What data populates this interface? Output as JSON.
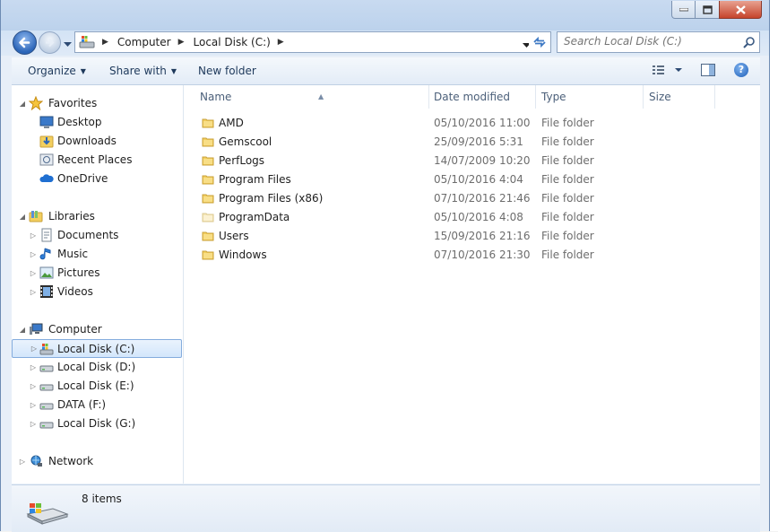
{
  "window": {
    "controls": {
      "minimize": "minimize-icon",
      "maximize": "maximize-icon",
      "close": "close-icon"
    }
  },
  "address": {
    "crumbs": [
      "Computer",
      "Local Disk (C:)"
    ],
    "icon": "local-disk-icon"
  },
  "search": {
    "placeholder": "Search Local Disk (C:)"
  },
  "toolbar": {
    "organize": "Organize",
    "share_with": "Share with",
    "new_folder": "New folder",
    "help": "?"
  },
  "nav": {
    "favorites": {
      "label": "Favorites",
      "items": [
        "Desktop",
        "Downloads",
        "Recent Places",
        "OneDrive"
      ]
    },
    "libraries": {
      "label": "Libraries",
      "items": [
        "Documents",
        "Music",
        "Pictures",
        "Videos"
      ]
    },
    "computer": {
      "label": "Computer",
      "items": [
        "Local Disk (C:)",
        "Local Disk (D:)",
        "Local Disk (E:)",
        "DATA (F:)",
        "Local Disk (G:)"
      ]
    },
    "network": {
      "label": "Network"
    }
  },
  "columns": {
    "name": "Name",
    "date": "Date modified",
    "type": "Type",
    "size": "Size"
  },
  "files": [
    {
      "name": "AMD",
      "date": "05/10/2016 11:00",
      "type": "File folder"
    },
    {
      "name": "Gemscool",
      "date": "25/09/2016 5:31",
      "type": "File folder"
    },
    {
      "name": "PerfLogs",
      "date": "14/07/2009 10:20",
      "type": "File folder"
    },
    {
      "name": "Program Files",
      "date": "05/10/2016 4:04",
      "type": "File folder"
    },
    {
      "name": "Program Files (x86)",
      "date": "07/10/2016 21:46",
      "type": "File folder"
    },
    {
      "name": "ProgramData",
      "date": "05/10/2016 4:08",
      "type": "File folder"
    },
    {
      "name": "Users",
      "date": "15/09/2016 21:16",
      "type": "File folder"
    },
    {
      "name": "Windows",
      "date": "07/10/2016 21:30",
      "type": "File folder"
    }
  ],
  "status": {
    "items_count": "8 items"
  },
  "colors": {
    "folder": "#f3cf5e",
    "selection": "#d3e6fb",
    "accent": "#2b65b8"
  }
}
